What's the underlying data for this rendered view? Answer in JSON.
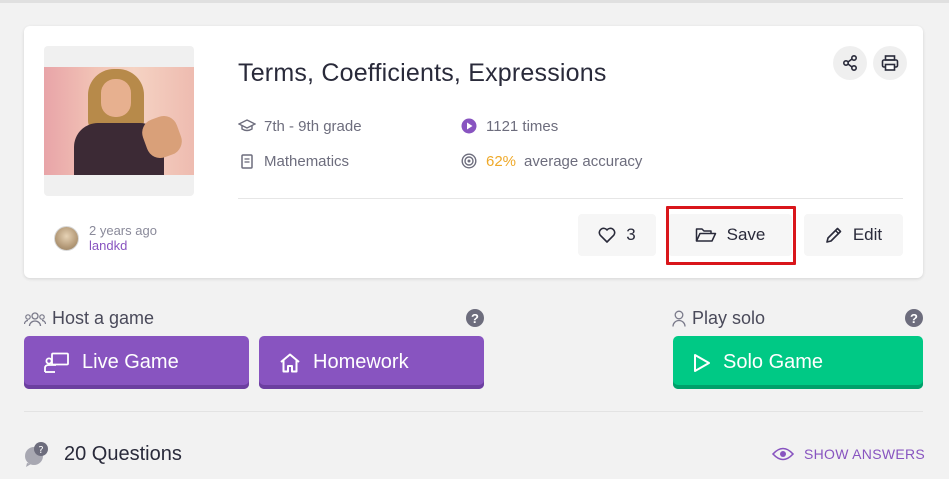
{
  "quiz": {
    "title": "Terms, Coefficients, Expressions",
    "grade": "7th - 9th grade",
    "subject": "Mathematics",
    "plays": "1121 times",
    "accuracy_value": "62%",
    "accuracy_label": "average accuracy"
  },
  "author": {
    "time": "2 years ago",
    "name": "landkd"
  },
  "actions": {
    "like_count": "3",
    "save_label": "Save",
    "edit_label": "Edit"
  },
  "host": {
    "label": "Host a game",
    "live_game": "Live Game",
    "homework": "Homework"
  },
  "solo": {
    "label": "Play solo",
    "solo_game": "Solo Game"
  },
  "questions": {
    "count_label": "20 Questions",
    "show_answers": "SHOW ANSWERS"
  },
  "colors": {
    "purple": "#8854c0",
    "green": "#00c985",
    "highlight_red": "#d9161b",
    "accuracy": "#efa929"
  },
  "icons": {
    "share": "share-icon",
    "print": "print-icon",
    "grade": "graduation-cap-icon",
    "subject": "book-icon",
    "plays": "play-circle-icon",
    "accuracy": "target-icon",
    "like": "heart-icon",
    "save": "folder-open-icon",
    "edit": "pencil-icon",
    "host": "users-icon",
    "solo": "user-icon",
    "help": "question-circle-icon",
    "live": "presentation-icon",
    "homework": "home-icon",
    "solo_game": "play-icon",
    "questions": "chat-bubbles-icon",
    "show_answers": "eye-icon"
  }
}
